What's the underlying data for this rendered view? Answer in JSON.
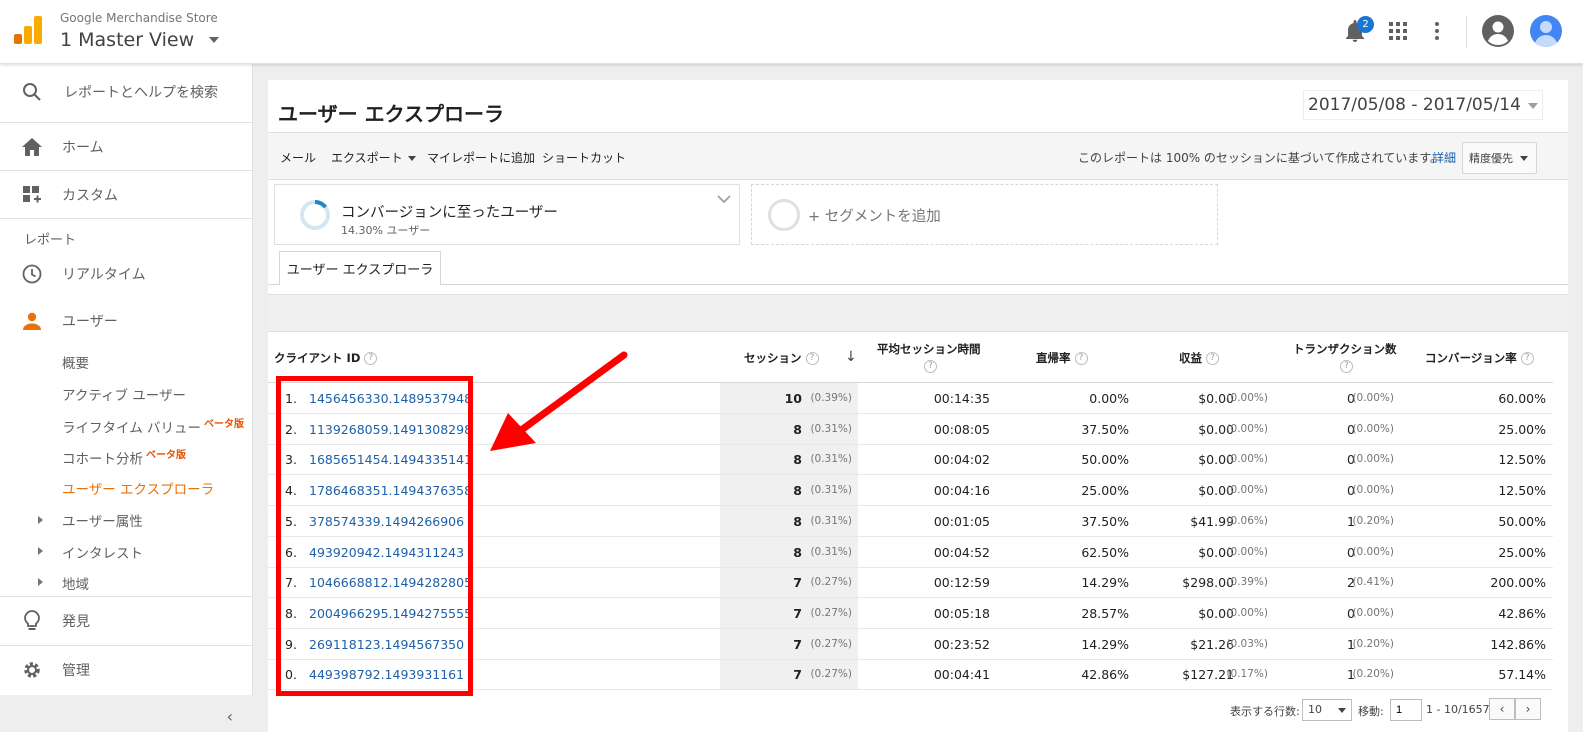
{
  "header": {
    "store_name": "Google Merchandise Store",
    "view_name": "1 Master View",
    "notification_count": "2",
    "colors": {
      "logo_orange": "#f9ab00",
      "logo_dark": "#e37400",
      "badge": "#1976d2"
    }
  },
  "sidebar": {
    "search_label": "レポートとヘルプを検索",
    "home_label": "ホーム",
    "custom_label": "カスタム",
    "reports_heading": "レポート",
    "realtime_label": "リアルタイム",
    "users_label": "ユーザー",
    "sub": {
      "overview": "概要",
      "active_users": "アクティブ ユーザー",
      "lifetime_value": "ライフタイム バリュー",
      "cohort": "コホート分析",
      "beta": "ベータ版",
      "user_explorer": "ユーザー エクスプローラ",
      "demographics": "ユーザー属性",
      "interests": "インタレスト",
      "geo": "地域"
    },
    "discover_label": "発見",
    "admin_label": "管理",
    "active_color": "#e8710a"
  },
  "report": {
    "title": "ユーザー エクスプローラ",
    "date_range": "2017/05/08 - 2017/05/14",
    "toolbar": {
      "email": "メール",
      "export": "エクスポート",
      "add_to_dashboard": "マイレポートに追加",
      "shortcut": "ショートカット",
      "sampling_note": "このレポートは 100% のセッションに基づいて作成されています。",
      "detail_link": "詳細",
      "precision": "精度優先"
    },
    "segment": {
      "name": "コンバージョンに至ったユーザー",
      "sub": "14.30% ユーザー",
      "add": "+ セグメントを追加"
    },
    "tab_label": "ユーザー エクスプローラ"
  },
  "table": {
    "headers": {
      "client_id": "クライアント ID",
      "sessions": "セッション",
      "avg_session": "平均セッション時間",
      "bounce": "直帰率",
      "revenue": "収益",
      "transactions": "トランザクション数",
      "conversion": "コンバージョン率"
    },
    "rows": [
      {
        "n": "1.",
        "id": "1456456330.1489537948",
        "sessions": "10",
        "sessions_pct": "(0.39%)",
        "dur": "00:14:35",
        "bounce": "0.00%",
        "rev": "$0.00",
        "rev_pct": "(0.00%)",
        "tx": "0",
        "tx_pct": "(0.00%)",
        "conv": "60.00%"
      },
      {
        "n": "2.",
        "id": "1139268059.1491308298",
        "sessions": "8",
        "sessions_pct": "(0.31%)",
        "dur": "00:08:05",
        "bounce": "37.50%",
        "rev": "$0.00",
        "rev_pct": "(0.00%)",
        "tx": "0",
        "tx_pct": "(0.00%)",
        "conv": "25.00%"
      },
      {
        "n": "3.",
        "id": "1685651454.1494335141",
        "sessions": "8",
        "sessions_pct": "(0.31%)",
        "dur": "00:04:02",
        "bounce": "50.00%",
        "rev": "$0.00",
        "rev_pct": "(0.00%)",
        "tx": "0",
        "tx_pct": "(0.00%)",
        "conv": "12.50%"
      },
      {
        "n": "4.",
        "id": "1786468351.1494376358",
        "sessions": "8",
        "sessions_pct": "(0.31%)",
        "dur": "00:04:16",
        "bounce": "25.00%",
        "rev": "$0.00",
        "rev_pct": "(0.00%)",
        "tx": "0",
        "tx_pct": "(0.00%)",
        "conv": "12.50%"
      },
      {
        "n": "5.",
        "id": "378574339.1494266906",
        "sessions": "8",
        "sessions_pct": "(0.31%)",
        "dur": "00:01:05",
        "bounce": "37.50%",
        "rev": "$41.99",
        "rev_pct": "(0.06%)",
        "tx": "1",
        "tx_pct": "(0.20%)",
        "conv": "50.00%"
      },
      {
        "n": "6.",
        "id": "493920942.1494311243",
        "sessions": "8",
        "sessions_pct": "(0.31%)",
        "dur": "00:04:52",
        "bounce": "62.50%",
        "rev": "$0.00",
        "rev_pct": "(0.00%)",
        "tx": "0",
        "tx_pct": "(0.00%)",
        "conv": "25.00%"
      },
      {
        "n": "7.",
        "id": "1046668812.1494282805",
        "sessions": "7",
        "sessions_pct": "(0.27%)",
        "dur": "00:12:59",
        "bounce": "14.29%",
        "rev": "$298.00",
        "rev_pct": "(0.39%)",
        "tx": "2",
        "tx_pct": "(0.41%)",
        "conv": "200.00%"
      },
      {
        "n": "8.",
        "id": "2004966295.1494275555",
        "sessions": "7",
        "sessions_pct": "(0.27%)",
        "dur": "00:05:18",
        "bounce": "28.57%",
        "rev": "$0.00",
        "rev_pct": "(0.00%)",
        "tx": "0",
        "tx_pct": "(0.00%)",
        "conv": "42.86%"
      },
      {
        "n": "9.",
        "id": "269118123.1494567350",
        "sessions": "7",
        "sessions_pct": "(0.27%)",
        "dur": "00:23:52",
        "bounce": "14.29%",
        "rev": "$21.26",
        "rev_pct": "(0.03%)",
        "tx": "1",
        "tx_pct": "(0.20%)",
        "conv": "142.86%"
      },
      {
        "n": "0.",
        "id": "449398792.1493931161",
        "sessions": "7",
        "sessions_pct": "(0.27%)",
        "dur": "00:04:41",
        "bounce": "42.86%",
        "rev": "$127.21",
        "rev_pct": "(0.17%)",
        "tx": "1",
        "tx_pct": "(0.20%)",
        "conv": "57.14%"
      }
    ]
  },
  "footer": {
    "rows_label": "表示する行数:",
    "rows_value": "10",
    "goto_label": "移動:",
    "goto_value": "1",
    "range": "1 - 10/1657",
    "prev": "‹",
    "next": "›"
  },
  "annotation": {
    "highlight_color": "#ff0000"
  }
}
